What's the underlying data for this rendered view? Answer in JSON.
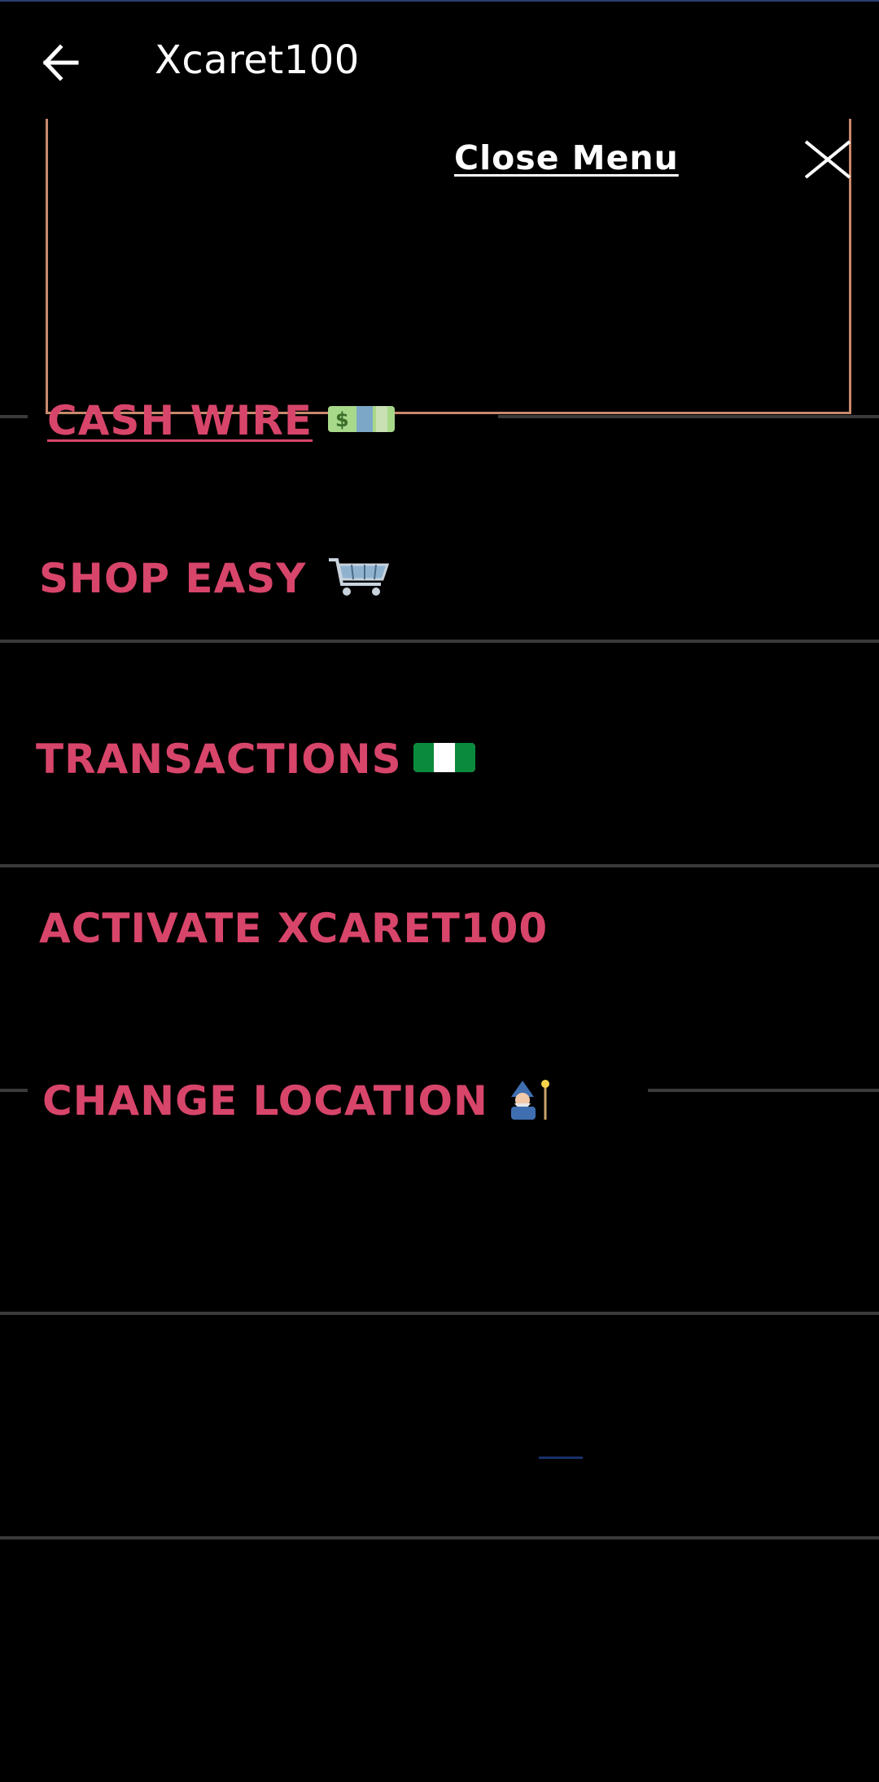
{
  "app_bar": {
    "title": "Xcaret100",
    "back_icon": "arrow-left-icon"
  },
  "menu": {
    "close_label": "Close Menu",
    "close_icon": "close-icon",
    "frame_color": "#c9896d",
    "items": [
      {
        "label": "CASH WIRE",
        "icon": "dollar-banknote-icon"
      },
      {
        "label": "SHOP EASY",
        "icon": "shopping-cart-icon"
      },
      {
        "label": "TRANSACTIONS",
        "icon": "nigeria-flag-icon"
      },
      {
        "label": "ACTIVATE XCARET100",
        "icon": ""
      },
      {
        "label": "CHANGE LOCATION",
        "icon": "mage-icon"
      }
    ]
  },
  "colors": {
    "background": "#000000",
    "item_text": "#d8456a",
    "divider": "#3a3a3a",
    "app_bar_text": "#ffffff"
  }
}
